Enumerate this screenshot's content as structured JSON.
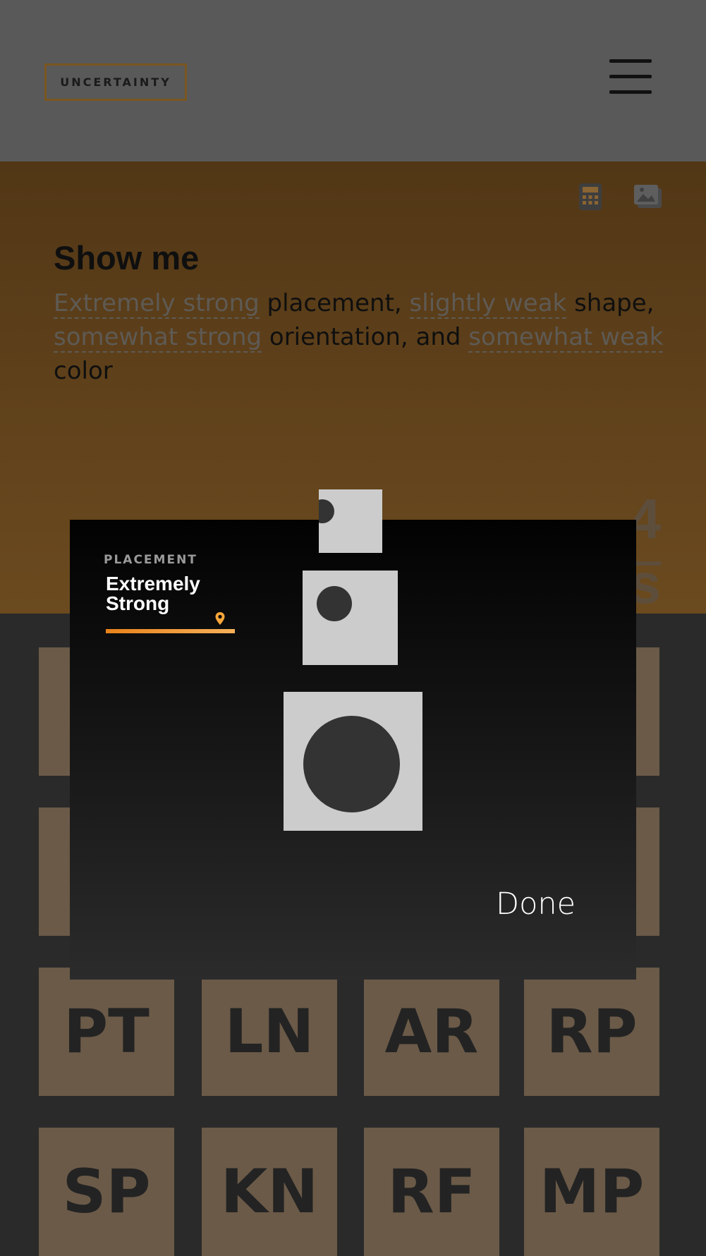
{
  "header": {
    "logo": "UNCERTAINTY",
    "menu_icon": "hamburger-menu-icon"
  },
  "toolbar": {
    "calculator_icon": "calculator-icon",
    "images_icon": "images-icon"
  },
  "query": {
    "title": "Show me",
    "placement_level": "Extremely strong",
    "placement_word": "placement,",
    "shape_level": "slightly weak",
    "shape_word": "shape,",
    "orientation_level": "somewhat strong",
    "orientation_word": "orientation, and",
    "color_level": "somewhat weak",
    "color_word": "color"
  },
  "results": {
    "count_label": "4 images"
  },
  "tiles": [
    "PT",
    "LN",
    "AR",
    "RP",
    "SP",
    "KN",
    "RF",
    "MP"
  ],
  "modal": {
    "label": "PLACEMENT",
    "value": "Extremely Strong",
    "slider_position_pct": 88,
    "done_label": "Done"
  },
  "colors": {
    "accent": "#e8821a",
    "header_bg": "#595959",
    "query_bg": "#5c3e19",
    "tile_bg": "#6b5a48"
  }
}
